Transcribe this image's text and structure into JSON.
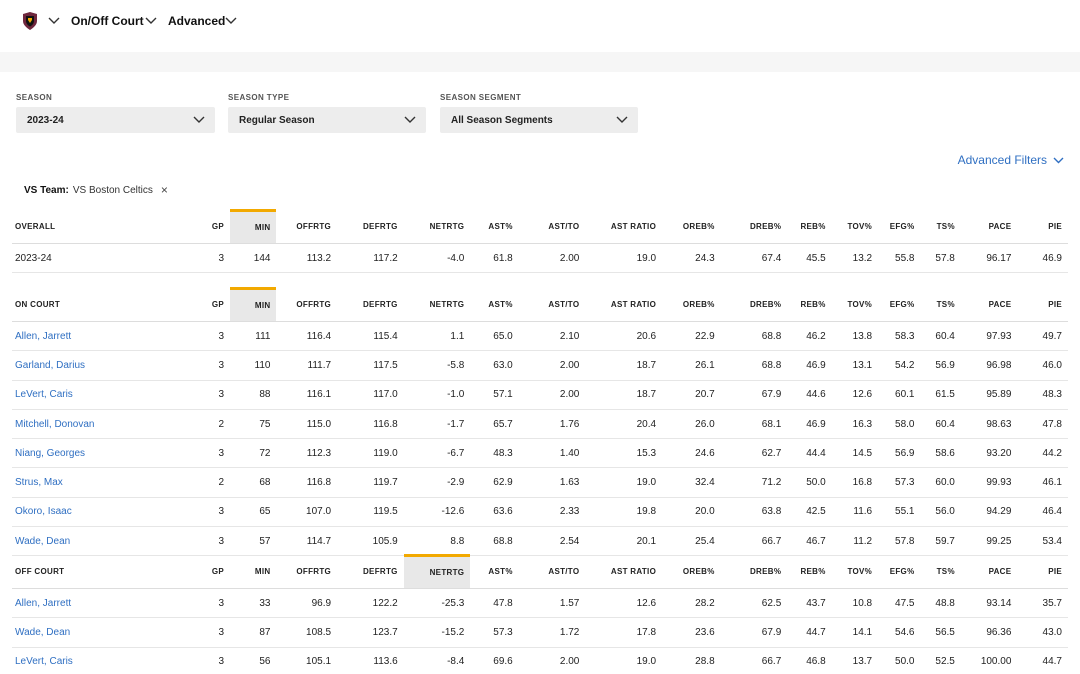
{
  "nav": {
    "menu1": "On/Off Court",
    "menu2": "Advanced"
  },
  "filters": {
    "season_label": "SEASON",
    "season_value": "2023-24",
    "season_type_label": "SEASON TYPE",
    "season_type_value": "Regular Season",
    "season_segment_label": "SEASON SEGMENT",
    "season_segment_value": "All Season Segments",
    "advanced_filters": "Advanced Filters",
    "chip_key": "VS Team:",
    "chip_value": "VS Boston Celtics",
    "chip_close": "×"
  },
  "columns": [
    "GP",
    "MIN",
    "OFFRTG",
    "DEFRTG",
    "NETRTG",
    "AST%",
    "AST/TO",
    "AST RATIO",
    "OREB%",
    "DREB%",
    "REB%",
    "TOV%",
    "EFG%",
    "TS%",
    "PACE",
    "PIE"
  ],
  "overall": {
    "title": "OVERALL",
    "rows": [
      {
        "name": "2023-24",
        "vals": [
          "3",
          "144",
          "113.2",
          "117.2",
          "-4.0",
          "61.8",
          "2.00",
          "19.0",
          "24.3",
          "67.4",
          "45.5",
          "13.2",
          "55.8",
          "57.8",
          "96.17",
          "46.9"
        ]
      }
    ]
  },
  "on_court": {
    "title": "ON COURT",
    "rows": [
      {
        "name": "Allen, Jarrett",
        "vals": [
          "3",
          "111",
          "116.4",
          "115.4",
          "1.1",
          "65.0",
          "2.10",
          "20.6",
          "22.9",
          "68.8",
          "46.2",
          "13.8",
          "58.3",
          "60.4",
          "97.93",
          "49.7"
        ]
      },
      {
        "name": "Garland, Darius",
        "vals": [
          "3",
          "110",
          "111.7",
          "117.5",
          "-5.8",
          "63.0",
          "2.00",
          "18.7",
          "26.1",
          "68.8",
          "46.9",
          "13.1",
          "54.2",
          "56.9",
          "96.98",
          "46.0"
        ]
      },
      {
        "name": "LeVert, Caris",
        "vals": [
          "3",
          "88",
          "116.1",
          "117.0",
          "-1.0",
          "57.1",
          "2.00",
          "18.7",
          "20.7",
          "67.9",
          "44.6",
          "12.6",
          "60.1",
          "61.5",
          "95.89",
          "48.3"
        ]
      },
      {
        "name": "Mitchell, Donovan",
        "vals": [
          "2",
          "75",
          "115.0",
          "116.8",
          "-1.7",
          "65.7",
          "1.76",
          "20.4",
          "26.0",
          "68.1",
          "46.9",
          "16.3",
          "58.0",
          "60.4",
          "98.63",
          "47.8"
        ]
      },
      {
        "name": "Niang, Georges",
        "vals": [
          "3",
          "72",
          "112.3",
          "119.0",
          "-6.7",
          "48.3",
          "1.40",
          "15.3",
          "24.6",
          "62.7",
          "44.4",
          "14.5",
          "56.9",
          "58.6",
          "93.20",
          "44.2"
        ]
      },
      {
        "name": "Strus, Max",
        "vals": [
          "2",
          "68",
          "116.8",
          "119.7",
          "-2.9",
          "62.9",
          "1.63",
          "19.0",
          "32.4",
          "71.2",
          "50.0",
          "16.8",
          "57.3",
          "60.0",
          "99.93",
          "46.1"
        ]
      },
      {
        "name": "Okoro, Isaac",
        "vals": [
          "3",
          "65",
          "107.0",
          "119.5",
          "-12.6",
          "63.6",
          "2.33",
          "19.8",
          "20.0",
          "63.8",
          "42.5",
          "11.6",
          "55.1",
          "56.0",
          "94.29",
          "46.4"
        ]
      },
      {
        "name": "Wade, Dean",
        "vals": [
          "3",
          "57",
          "114.7",
          "105.9",
          "8.8",
          "68.8",
          "2.54",
          "20.1",
          "25.4",
          "66.7",
          "46.7",
          "11.2",
          "57.8",
          "59.7",
          "99.25",
          "53.4"
        ]
      }
    ]
  },
  "off_court": {
    "title": "OFF COURT",
    "rows": [
      {
        "name": "Allen, Jarrett",
        "vals": [
          "3",
          "33",
          "96.9",
          "122.2",
          "-25.3",
          "47.8",
          "1.57",
          "12.6",
          "28.2",
          "62.5",
          "43.7",
          "10.8",
          "47.5",
          "48.8",
          "93.14",
          "35.7"
        ]
      },
      {
        "name": "Wade, Dean",
        "vals": [
          "3",
          "87",
          "108.5",
          "123.7",
          "-15.2",
          "57.3",
          "1.72",
          "17.8",
          "23.6",
          "67.9",
          "44.7",
          "14.1",
          "54.6",
          "56.5",
          "96.36",
          "43.0"
        ]
      },
      {
        "name": "LeVert, Caris",
        "vals": [
          "3",
          "56",
          "105.1",
          "113.6",
          "-8.4",
          "69.6",
          "2.00",
          "19.0",
          "28.8",
          "66.7",
          "46.8",
          "13.7",
          "50.0",
          "52.5",
          "100.00",
          "44.7"
        ]
      }
    ]
  },
  "colors": {
    "accent": "#f2a900",
    "link": "#2f6fc2",
    "team": "#6f263d"
  }
}
